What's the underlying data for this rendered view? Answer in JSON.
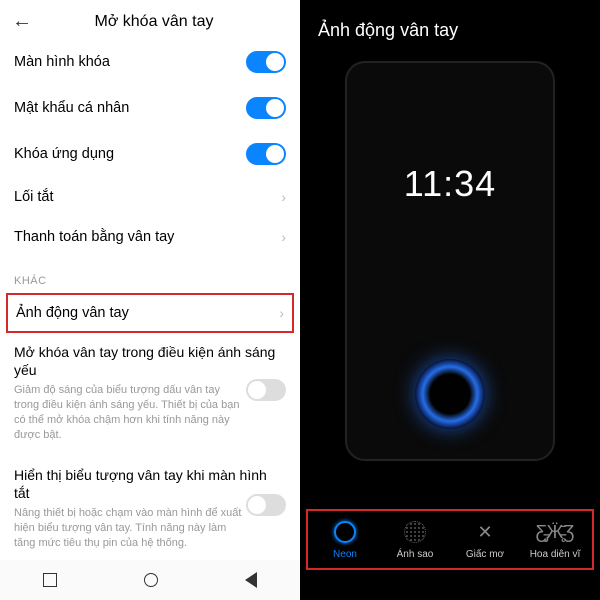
{
  "left": {
    "title": "Mở khóa vân tay",
    "rows": [
      {
        "label": "Màn hình khóa",
        "toggle": true
      },
      {
        "label": "Mật khẩu cá nhân",
        "toggle": true
      },
      {
        "label": "Khóa ứng dụng",
        "toggle": true
      },
      {
        "label": "Lối tắt",
        "chevron": true
      },
      {
        "label": "Thanh toán bằng vân tay",
        "chevron": true
      }
    ],
    "section": "KHÁC",
    "highlighted": {
      "label": "Ảnh động vân tay"
    },
    "sub1": {
      "title": "Mở khóa vân tay trong điều kiện ánh sáng yếu",
      "desc": "Giảm độ sáng của biểu tượng dấu vân tay trong điều kiện ánh sáng yếu. Thiết bị của bạn có thể mở khóa chậm hơn khi tính năng này được bật."
    },
    "sub2": {
      "title": "Hiển thị biểu tượng vân tay khi màn hình tắt",
      "desc": "Nâng thiết bị hoặc chạm vào màn hình để xuất hiện biểu tượng vân tay. Tính năng này làm tăng mức tiêu thụ pin của hệ thống."
    }
  },
  "right": {
    "title": "Ảnh động vân tay",
    "clock": "11:34",
    "options": [
      {
        "label": "Neon",
        "selected": true
      },
      {
        "label": "Ánh sao",
        "selected": false
      },
      {
        "label": "Giấc mơ",
        "selected": false
      },
      {
        "label": "Hoa diên vĩ",
        "selected": false
      }
    ]
  }
}
